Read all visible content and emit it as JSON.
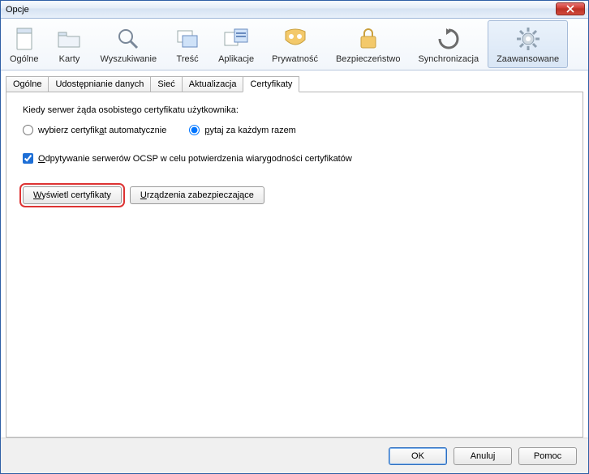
{
  "window": {
    "title": "Opcje"
  },
  "toolbar": {
    "items": [
      {
        "id": "general",
        "label": "Ogólne"
      },
      {
        "id": "cards",
        "label": "Karty"
      },
      {
        "id": "search",
        "label": "Wyszukiwanie"
      },
      {
        "id": "content",
        "label": "Treść"
      },
      {
        "id": "apps",
        "label": "Aplikacje"
      },
      {
        "id": "privacy",
        "label": "Prywatność"
      },
      {
        "id": "security",
        "label": "Bezpieczeństwo"
      },
      {
        "id": "sync",
        "label": "Synchronizacja"
      },
      {
        "id": "advanced",
        "label": "Zaawansowane",
        "selected": true
      }
    ]
  },
  "subtabs": {
    "items": [
      {
        "id": "general2",
        "label": "Ogólne"
      },
      {
        "id": "datashare",
        "label": "Udostępnianie danych"
      },
      {
        "id": "network",
        "label": "Sieć"
      },
      {
        "id": "update",
        "label": "Aktualizacja"
      },
      {
        "id": "certs",
        "label": "Certyfikaty",
        "active": true
      }
    ]
  },
  "panel": {
    "prompt": "Kiedy serwer żąda osobistego certyfikatu użytkownika:",
    "radio_auto_pre": "wybierz certyfik",
    "radio_auto_accel": "a",
    "radio_auto_post": "t automatycznie",
    "radio_ask_accel": "p",
    "radio_ask_post": "ytaj za każdym razem",
    "ocsp_accel": "O",
    "ocsp_post": "dpytywanie serwerów OCSP w celu potwierdzenia wiarygodności certyfikatów",
    "view_certs_accel": "W",
    "view_certs_post": "yświetl certyfikaty",
    "sec_devices_accel": "U",
    "sec_devices_post": "rządzenia zabezpieczające"
  },
  "footer": {
    "ok": "OK",
    "cancel": "Anuluj",
    "help": "Pomoc"
  },
  "state": {
    "radio_selected": "ask",
    "ocsp_checked": true
  }
}
